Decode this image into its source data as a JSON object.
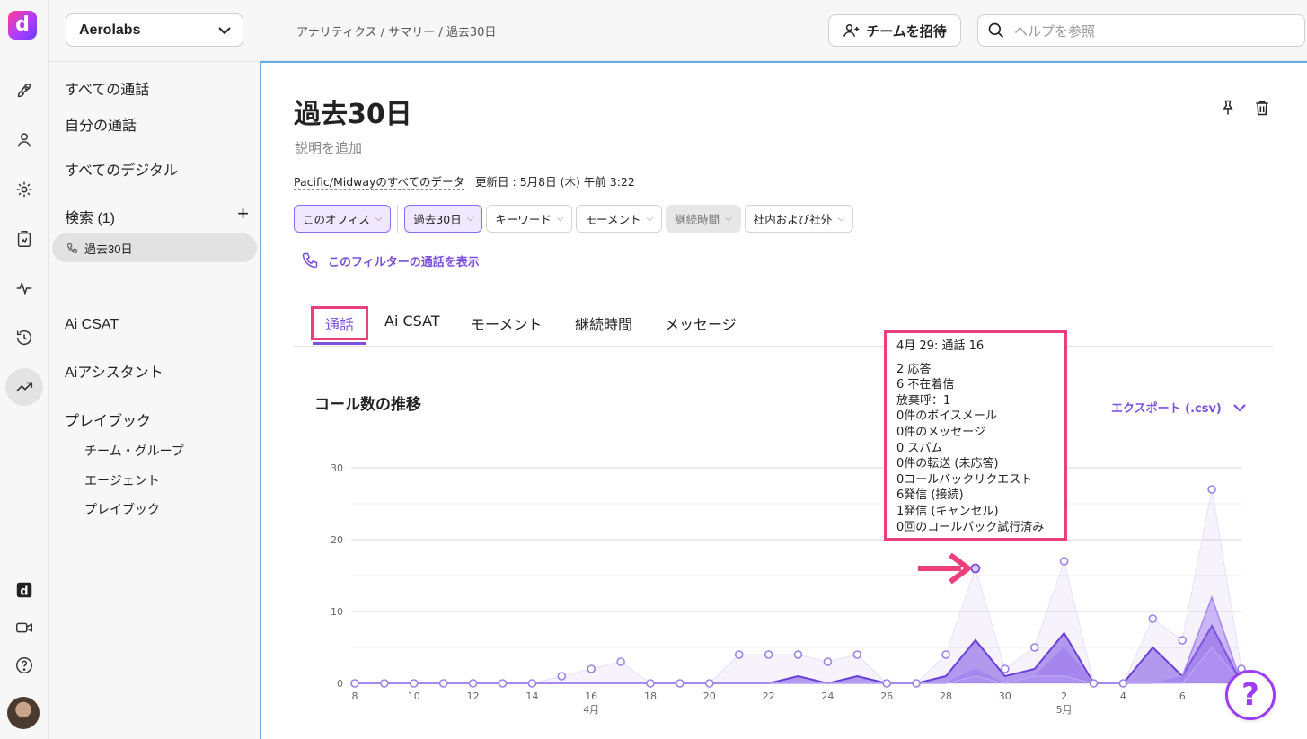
{
  "app": {
    "logo_letter": "d",
    "accent": "#7b4fe0",
    "highlight": "#ec3f7c"
  },
  "rail": {
    "icons": [
      "rocket-icon",
      "person-icon",
      "gear-icon",
      "clipboard-icon",
      "pulse-icon",
      "history-icon",
      "trend-icon",
      "ai-d-icon",
      "video-icon",
      "help-icon"
    ]
  },
  "sidebar": {
    "workspace": "Aerolabs",
    "items": [
      {
        "label": "すべての通話"
      },
      {
        "label": "自分の通話"
      },
      {
        "label": "すべてのデジタル"
      }
    ],
    "search_label": "検索 (1)",
    "saved_search": "過去30日",
    "ai_csat": "Ai CSAT",
    "ai_assistant": "Aiアシスタント",
    "playbook": "プレイブック",
    "playbook_items": [
      {
        "label": "チーム・グループ"
      },
      {
        "label": "エージェント"
      },
      {
        "label": "プレイブック"
      }
    ]
  },
  "topbar": {
    "breadcrumb": "アナリティクス / サマリー / 過去30日",
    "invite_label": "チームを招待",
    "help_placeholder": "ヘルプを参照"
  },
  "main": {
    "title": "過去30日",
    "description_placeholder": "説明を追加",
    "data_scope": "Pacific/Midwayのすべてのデータ",
    "updated": "更新日 : 5月8日 (木) 午前 3:22",
    "filters": [
      {
        "label": "このオフィス",
        "state": "selected"
      },
      {
        "label": "過去30日",
        "state": "selected"
      },
      {
        "label": "キーワード",
        "state": "normal"
      },
      {
        "label": "モーメント",
        "state": "normal"
      },
      {
        "label": "継続時間",
        "state": "disabled"
      },
      {
        "label": "社内および社外",
        "state": "normal"
      }
    ],
    "show_calls": "このフィルターの通話を表示",
    "tabs": [
      {
        "label": "通話"
      },
      {
        "label": "Ai CSAT"
      },
      {
        "label": "モーメント"
      },
      {
        "label": "継続時間"
      },
      {
        "label": "メッセージ"
      }
    ],
    "chart_title": "コール数の推移",
    "export_label": "エクスポート (.csv)"
  },
  "tooltip": {
    "header": "4月 29: 通話 16",
    "lines": [
      "2 応答",
      "6 不在着信",
      "放棄呼：1",
      "0件のボイスメール",
      "0件のメッセージ",
      "0 スパム",
      "0件の転送 (未応答)",
      "0コールバックリクエスト",
      "6発信 (接続)",
      "1発信 (キャンセル)",
      "0回のコールバック試行済み"
    ]
  },
  "chart_data": {
    "type": "area",
    "title": "コール数の推移",
    "ylim": [
      0,
      30
    ],
    "yticks": [
      0,
      10,
      20,
      30
    ],
    "x": [
      "4/8",
      "4/9",
      "4/10",
      "4/11",
      "4/12",
      "4/13",
      "4/14",
      "4/15",
      "4/16",
      "4/17",
      "4/18",
      "4/19",
      "4/20",
      "4/21",
      "4/22",
      "4/23",
      "4/24",
      "4/25",
      "4/26",
      "4/27",
      "4/28",
      "4/29",
      "4/30",
      "5/1",
      "5/2",
      "5/3",
      "5/4",
      "5/5",
      "5/6",
      "5/7",
      "5/8"
    ],
    "xtick_labels": [
      "8",
      "10",
      "12",
      "14",
      "16",
      "18",
      "20",
      "22",
      "24",
      "26",
      "28",
      "30",
      "2",
      "4",
      "6"
    ],
    "xtick_index": [
      0,
      2,
      4,
      6,
      8,
      10,
      12,
      14,
      16,
      18,
      20,
      22,
      24,
      26,
      28
    ],
    "month_labels": [
      {
        "label": "4月",
        "index": 8
      },
      {
        "label": "5月",
        "index": 24
      }
    ],
    "series": [
      {
        "values": [
          0,
          0,
          0,
          0,
          0,
          0,
          0,
          1,
          2,
          3,
          0,
          0,
          0,
          4,
          4,
          4,
          3,
          4,
          0,
          0,
          4,
          16,
          2,
          5,
          17,
          0,
          0,
          9,
          6,
          27,
          2
        ]
      },
      {
        "values": [
          0,
          0,
          0,
          0,
          0,
          0,
          0,
          0,
          0,
          0,
          0,
          0,
          0,
          0,
          0,
          1,
          0,
          1,
          0,
          0,
          1,
          6,
          1,
          2,
          7,
          0,
          0,
          5,
          1,
          8,
          0
        ]
      },
      {
        "values": [
          0,
          0,
          0,
          0,
          0,
          0,
          0,
          0,
          0,
          0,
          0,
          0,
          0,
          0,
          0,
          0,
          0,
          0,
          0,
          0,
          0,
          2,
          0,
          1,
          5,
          0,
          0,
          0,
          1,
          12,
          0
        ]
      },
      {
        "values": [
          0,
          0,
          0,
          0,
          0,
          0,
          0,
          0,
          0,
          0,
          0,
          0,
          0,
          0,
          0,
          0,
          0,
          0,
          0,
          0,
          0,
          1,
          0,
          1,
          1,
          0,
          0,
          0,
          0,
          5,
          0
        ]
      }
    ],
    "grid": true
  }
}
